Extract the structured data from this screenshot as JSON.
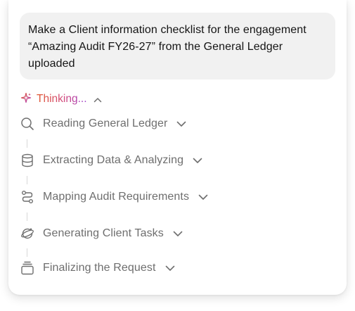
{
  "prompt": {
    "text": "Make a Client information checklist for the engagement “Amazing Audit FY26-27” from the General Ledger uploaded"
  },
  "status": {
    "label": "Thinking...",
    "icon": "sparkle-icon"
  },
  "steps": [
    {
      "label": "Reading General Ledger",
      "icon": "search-icon"
    },
    {
      "label": "Extracting Data & Analyzing",
      "icon": "database-icon"
    },
    {
      "label": "Mapping Audit Requirements",
      "icon": "route-icon"
    },
    {
      "label": "Generating Client Tasks",
      "icon": "orbit-icon"
    },
    {
      "label": "Finalizing the Request",
      "icon": "stack-icon"
    }
  ],
  "colors": {
    "prompt_bg": "#f1f1f1",
    "step_text": "#6e6e6e",
    "thinking_gradient_start": "#e0562d",
    "thinking_gradient_end": "#9a3fd0"
  }
}
